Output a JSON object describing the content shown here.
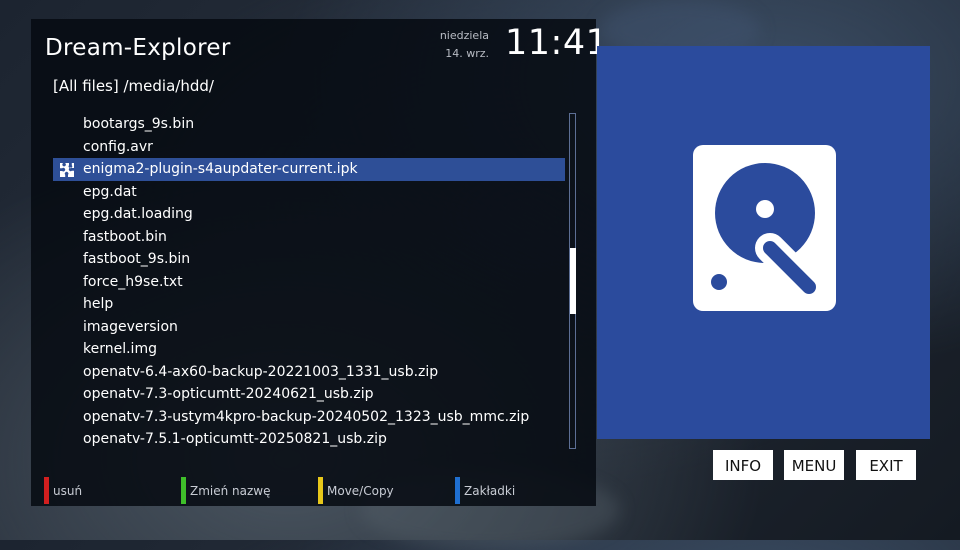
{
  "app": {
    "title": "Dream-Explorer",
    "day": "niedziela",
    "date": "14. wrz.",
    "time": "11:41"
  },
  "path": "[All files] /media/hdd/",
  "files": [
    {
      "name": "bootargs_9s.bin",
      "selected": false
    },
    {
      "name": "config.avr",
      "selected": false
    },
    {
      "name": "enigma2-plugin-s4aupdater-current.ipk",
      "selected": true,
      "icon": "puzzle-icon"
    },
    {
      "name": "epg.dat",
      "selected": false
    },
    {
      "name": "epg.dat.loading",
      "selected": false
    },
    {
      "name": "fastboot.bin",
      "selected": false
    },
    {
      "name": "fastboot_9s.bin",
      "selected": false
    },
    {
      "name": "force_h9se.txt",
      "selected": false
    },
    {
      "name": "help",
      "selected": false
    },
    {
      "name": "imageversion",
      "selected": false
    },
    {
      "name": "kernel.img",
      "selected": false
    },
    {
      "name": "openatv-6.4-ax60-backup-20221003_1331_usb.zip",
      "selected": false
    },
    {
      "name": "openatv-7.3-opticumtt-20240621_usb.zip",
      "selected": false
    },
    {
      "name": "openatv-7.3-ustym4kpro-backup-20240502_1323_usb_mmc.zip",
      "selected": false
    },
    {
      "name": "openatv-7.5.1-opticumtt-20250821_usb.zip",
      "selected": false
    }
  ],
  "color_keys": [
    {
      "label": "usuń",
      "color": "#d21f1f"
    },
    {
      "label": "Zmień nazwę",
      "color": "#3fbf2a"
    },
    {
      "label": "Move/Copy",
      "color": "#e8c81a"
    },
    {
      "label": "Zakładki",
      "color": "#1f6fd0"
    }
  ],
  "buttons": {
    "info": "INFO",
    "menu": "MENU",
    "exit": "EXIT"
  },
  "preview": {
    "icon": "hard-drive-icon",
    "bg_color": "#2b4b9d"
  },
  "colors": {
    "selection": "#2e4f97",
    "panel_bg": "#060a12"
  }
}
